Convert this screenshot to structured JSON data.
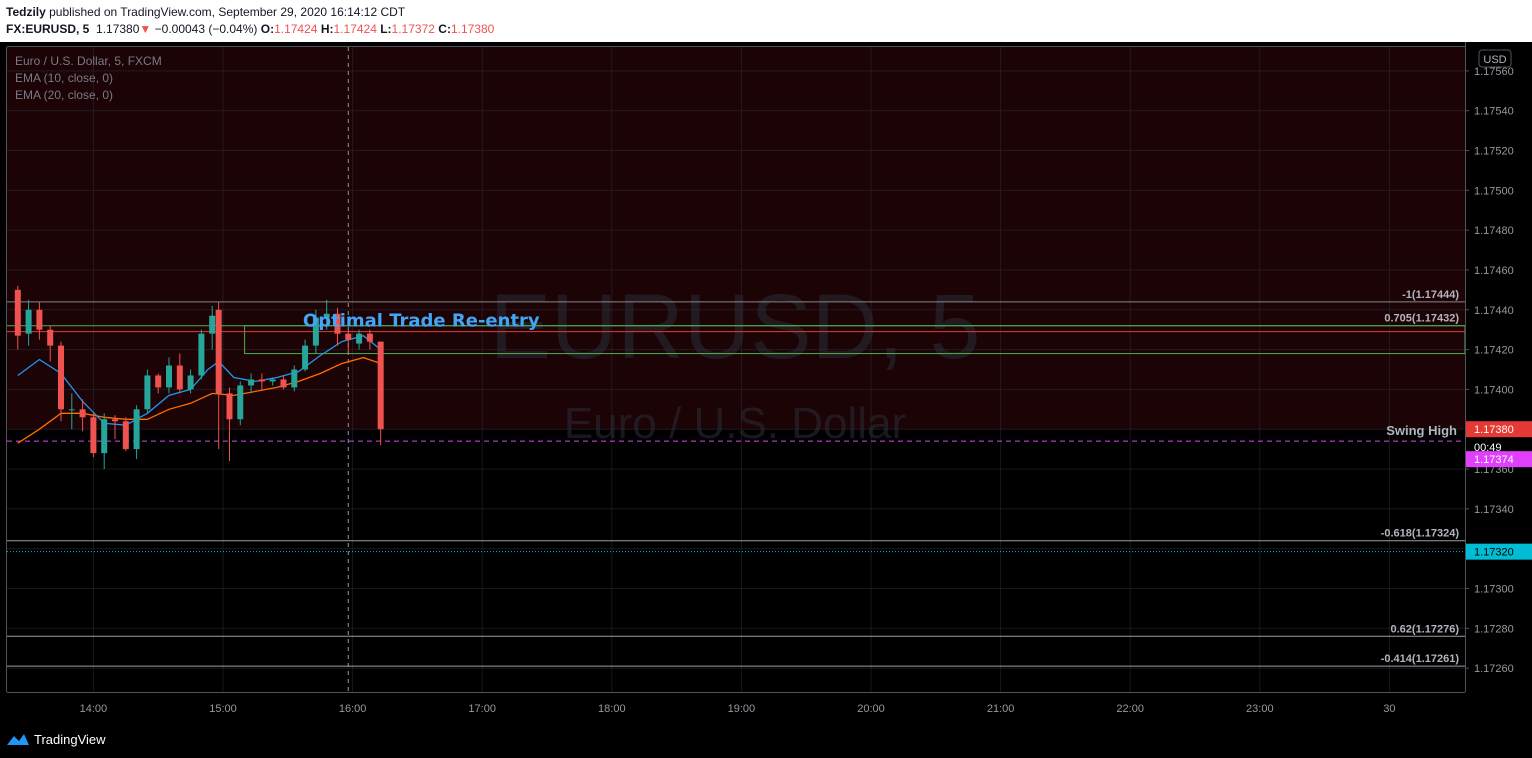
{
  "header": {
    "author": "Tedzily",
    "published": " published on TradingView.com, September 29, 2020 16:14:12 CDT",
    "symbol": "FX:EURUSD, 5",
    "last": "1.17380",
    "change": "−0.00043 (−0.04%)",
    "o_label": "O:",
    "o_value": "1.17424",
    "h_label": "H:",
    "h_value": "1.17424",
    "l_label": "L:",
    "l_value": "1.17372",
    "c_label": "C:",
    "c_value": "1.17380"
  },
  "legend": {
    "name": "Euro / U.S. Dollar, 5, FXCM",
    "ema10": "EMA (10, close, 0)",
    "ema20": "EMA (20, close, 0)"
  },
  "watermark": {
    "symbol": "EURUSD, 5",
    "description": "Euro / U.S. Dollar"
  },
  "footer": {
    "brand": "TradingView"
  },
  "colors": {
    "up": "#26a69a",
    "down": "#ef5350",
    "ema10": "#2196f3",
    "ema20": "#ff6d00",
    "premium_zone": "#1c0305",
    "fib_zone_border": "#4caf50",
    "annotation": "#42a5f5",
    "swing_line": "#e040fb",
    "price_tag": "#e53935",
    "cyan_tag": "#00bcd4"
  },
  "chart_data": {
    "type": "candlestick",
    "currency": "USD",
    "ylim": [
      1.17248,
      1.17572
    ],
    "y_ticks": [
      1.1726,
      1.1728,
      1.173,
      1.1732,
      1.1734,
      1.1736,
      1.1738,
      1.174,
      1.1742,
      1.1744,
      1.1746,
      1.1748,
      1.175,
      1.1752,
      1.1754,
      1.1756
    ],
    "y_tick_labels": [
      "1.17260",
      "1.17280",
      "1.17300",
      "1.17320",
      "1.17340",
      "1.17360",
      "1.17380",
      "1.17400",
      "1.17420",
      "1.17440",
      "1.17460",
      "1.17480",
      "1.17500",
      "1.17520",
      "1.17540",
      "1.17560"
    ],
    "x_ticks": [
      {
        "label": "14:00",
        "minutes": 840
      },
      {
        "label": "15:00",
        "minutes": 900
      },
      {
        "label": "16:00",
        "minutes": 960
      },
      {
        "label": "17:00",
        "minutes": 1020
      },
      {
        "label": "18:00",
        "minutes": 1080
      },
      {
        "label": "19:00",
        "minutes": 1140
      },
      {
        "label": "20:00",
        "minutes": 1200
      },
      {
        "label": "21:00",
        "minutes": 1260
      },
      {
        "label": "22:00",
        "minutes": 1320
      },
      {
        "label": "23:00",
        "minutes": 1380
      },
      {
        "label": "30",
        "minutes": 1440
      }
    ],
    "xlim_minutes": [
      800,
      1475
    ],
    "candles": [
      {
        "t": 805,
        "o": 1.1745,
        "h": 1.17452,
        "l": 1.1742,
        "c": 1.17427
      },
      {
        "t": 810,
        "o": 1.17428,
        "h": 1.17445,
        "l": 1.17422,
        "c": 1.1744
      },
      {
        "t": 815,
        "o": 1.1744,
        "h": 1.17444,
        "l": 1.17425,
        "c": 1.1743
      },
      {
        "t": 820,
        "o": 1.1743,
        "h": 1.17432,
        "l": 1.17414,
        "c": 1.17422
      },
      {
        "t": 825,
        "o": 1.17422,
        "h": 1.17424,
        "l": 1.17384,
        "c": 1.1739
      },
      {
        "t": 830,
        "o": 1.1739,
        "h": 1.17398,
        "l": 1.1738,
        "c": 1.1739
      },
      {
        "t": 835,
        "o": 1.1739,
        "h": 1.17395,
        "l": 1.17379,
        "c": 1.17386
      },
      {
        "t": 840,
        "o": 1.17386,
        "h": 1.17388,
        "l": 1.17366,
        "c": 1.17368
      },
      {
        "t": 845,
        "o": 1.17368,
        "h": 1.17388,
        "l": 1.1736,
        "c": 1.17385
      },
      {
        "t": 850,
        "o": 1.17385,
        "h": 1.17387,
        "l": 1.17375,
        "c": 1.17384
      },
      {
        "t": 855,
        "o": 1.17384,
        "h": 1.17386,
        "l": 1.17369,
        "c": 1.1737
      },
      {
        "t": 860,
        "o": 1.1737,
        "h": 1.17392,
        "l": 1.17365,
        "c": 1.1739
      },
      {
        "t": 865,
        "o": 1.1739,
        "h": 1.1741,
        "l": 1.17388,
        "c": 1.17407
      },
      {
        "t": 870,
        "o": 1.17407,
        "h": 1.17408,
        "l": 1.17398,
        "c": 1.17401
      },
      {
        "t": 875,
        "o": 1.17401,
        "h": 1.17416,
        "l": 1.17398,
        "c": 1.17412
      },
      {
        "t": 880,
        "o": 1.17412,
        "h": 1.17418,
        "l": 1.17398,
        "c": 1.174
      },
      {
        "t": 885,
        "o": 1.174,
        "h": 1.1741,
        "l": 1.17398,
        "c": 1.17407
      },
      {
        "t": 890,
        "o": 1.17407,
        "h": 1.1743,
        "l": 1.17405,
        "c": 1.17428
      },
      {
        "t": 895,
        "o": 1.17428,
        "h": 1.17442,
        "l": 1.1742,
        "c": 1.17437
      },
      {
        "t": 898,
        "o": 1.1744,
        "h": 1.17444,
        "l": 1.1737,
        "c": 1.17398
      },
      {
        "t": 903,
        "o": 1.17398,
        "h": 1.17401,
        "l": 1.17364,
        "c": 1.17385
      },
      {
        "t": 908,
        "o": 1.17385,
        "h": 1.17404,
        "l": 1.17382,
        "c": 1.17402
      },
      {
        "t": 913,
        "o": 1.17402,
        "h": 1.17408,
        "l": 1.17398,
        "c": 1.17405
      },
      {
        "t": 918,
        "o": 1.17405,
        "h": 1.17408,
        "l": 1.174,
        "c": 1.17404
      },
      {
        "t": 923,
        "o": 1.17404,
        "h": 1.17406,
        "l": 1.17402,
        "c": 1.17405
      },
      {
        "t": 928,
        "o": 1.17405,
        "h": 1.17407,
        "l": 1.174,
        "c": 1.17401
      },
      {
        "t": 933,
        "o": 1.17401,
        "h": 1.17412,
        "l": 1.17399,
        "c": 1.1741
      },
      {
        "t": 938,
        "o": 1.1741,
        "h": 1.17425,
        "l": 1.17409,
        "c": 1.17422
      },
      {
        "t": 943,
        "o": 1.17422,
        "h": 1.1744,
        "l": 1.17418,
        "c": 1.17436
      },
      {
        "t": 948,
        "o": 1.17436,
        "h": 1.17445,
        "l": 1.1743,
        "c": 1.17438
      },
      {
        "t": 953,
        "o": 1.17438,
        "h": 1.17441,
        "l": 1.17422,
        "c": 1.17428
      },
      {
        "t": 958,
        "o": 1.17428,
        "h": 1.1743,
        "l": 1.17418,
        "c": 1.17425
      },
      {
        "t": 963,
        "o": 1.17423,
        "h": 1.1743,
        "l": 1.1742,
        "c": 1.17428
      },
      {
        "t": 968,
        "o": 1.17428,
        "h": 1.1743,
        "l": 1.1742,
        "c": 1.17424
      },
      {
        "t": 973,
        "o": 1.17424,
        "h": 1.17424,
        "l": 1.17372,
        "c": 1.1738
      }
    ],
    "ema10": [
      [
        805,
        1.17407
      ],
      [
        815,
        1.17415
      ],
      [
        825,
        1.17408
      ],
      [
        835,
        1.17394
      ],
      [
        845,
        1.17383
      ],
      [
        855,
        1.17382
      ],
      [
        865,
        1.17388
      ],
      [
        875,
        1.17397
      ],
      [
        885,
        1.174
      ],
      [
        893,
        1.1741
      ],
      [
        898,
        1.17414
      ],
      [
        905,
        1.17406
      ],
      [
        915,
        1.17404
      ],
      [
        925,
        1.17406
      ],
      [
        935,
        1.17409
      ],
      [
        945,
        1.17417
      ],
      [
        955,
        1.17424
      ],
      [
        965,
        1.17427
      ],
      [
        973,
        1.1742
      ]
    ],
    "ema20": [
      [
        805,
        1.17373
      ],
      [
        815,
        1.1738
      ],
      [
        825,
        1.17388
      ],
      [
        835,
        1.17388
      ],
      [
        845,
        1.17386
      ],
      [
        855,
        1.17385
      ],
      [
        865,
        1.17385
      ],
      [
        875,
        1.1739
      ],
      [
        885,
        1.17393
      ],
      [
        895,
        1.17398
      ],
      [
        905,
        1.17397
      ],
      [
        915,
        1.17399
      ],
      [
        925,
        1.17401
      ],
      [
        935,
        1.17404
      ],
      [
        945,
        1.17408
      ],
      [
        955,
        1.17413
      ],
      [
        965,
        1.17416
      ],
      [
        973,
        1.17413
      ]
    ],
    "fib_levels": [
      {
        "label": "-1(1.17444)",
        "value": 1.17444,
        "color": "#888888"
      },
      {
        "label": "0.705(1.17432)",
        "value": 1.17432,
        "color": "#4caf50"
      },
      {
        "label": "-0.618(1.17324)",
        "value": 1.17324,
        "color": "#9e9e9e"
      },
      {
        "label": "0.62(1.17276)",
        "value": 1.17276,
        "color": "#9e9e9e"
      },
      {
        "label": "-0.414(1.17261)",
        "value": 1.17261,
        "color": "#9e9e9e"
      }
    ],
    "red_level": 1.17429,
    "fib_zone": {
      "top": 1.17432,
      "bottom": 1.17418,
      "start_minutes": 910
    },
    "premium_zone": {
      "top": 1.17572,
      "bottom": 1.1738
    },
    "annotation": {
      "text": "Optimal Trade Re-entry",
      "value": 1.17435,
      "minutes": 937
    },
    "swing_high": {
      "label": "Swing High",
      "value": 1.17374
    },
    "cyan_line": 1.1732,
    "crosshair_minutes": 958,
    "price_tags": [
      {
        "text": "1.17380",
        "value": 1.1738,
        "kind": "last"
      },
      {
        "text": "00:49",
        "value": 1.1737,
        "kind": "timer"
      },
      {
        "text": "1.17374",
        "value": 1.17374,
        "kind": "swing"
      },
      {
        "text": "1.17320",
        "value": 1.1732,
        "kind": "cyan"
      }
    ]
  }
}
